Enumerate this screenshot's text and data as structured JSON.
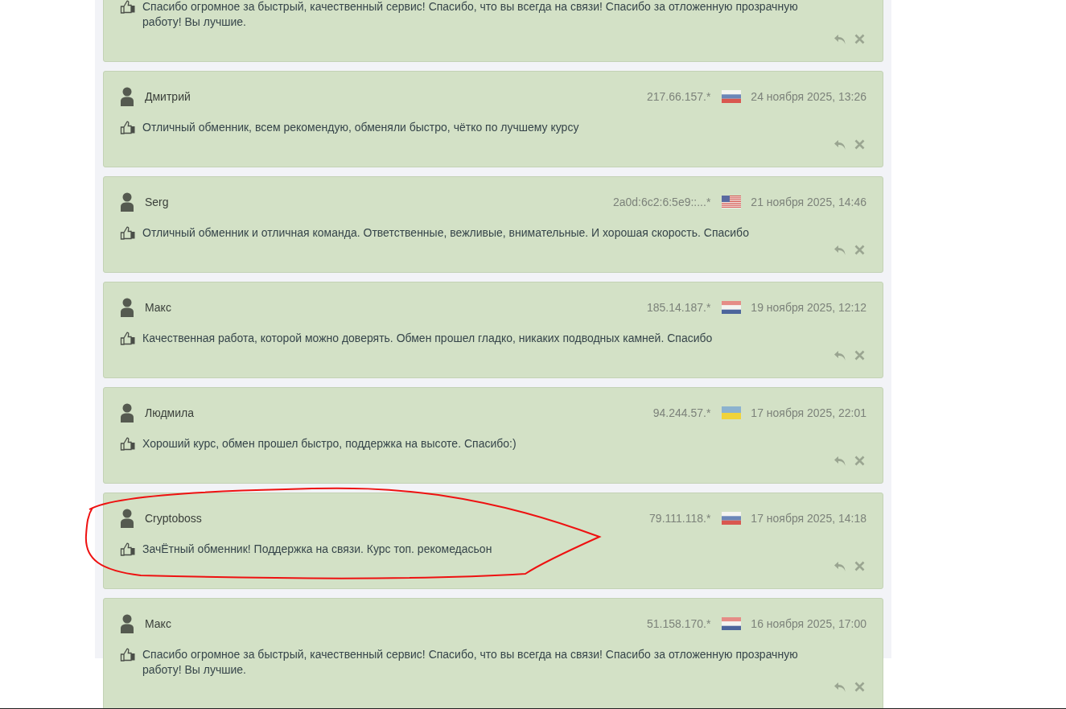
{
  "reviews": [
    {
      "text": "Спасибо огромное за быстрый, качественный сервис! Спасибо, что вы всегда на связи! Спасибо за отложенную прозрачную работу! Вы лучшие.",
      "circled": false
    },
    {
      "name": "Дмитрий",
      "ip": "217.66.157.*",
      "flag": {
        "kind": "ru"
      },
      "date": "24 ноября 2025, 13:26",
      "text": "Отличный обменник, всем рекомендую, обменяли быстро, чётко по лучшему курсу",
      "circled": false
    },
    {
      "name": "Serg",
      "ip": "2a0d:6c2:6:5e9::...*",
      "flag": {
        "kind": "us"
      },
      "date": "21 ноября 2025, 14:46",
      "text": "Отличный обменник и отличная команда. Ответственные, вежливые, внимательные. И хорошая скорость. Спасибо",
      "circled": false
    },
    {
      "name": "Макс",
      "ip": "185.14.187.*",
      "flag": {
        "kind": "nl"
      },
      "date": "19 ноября 2025, 12:12",
      "text": "Качественная работа, которой можно доверять. Обмен прошел гладко, никаких подводных камней. Спасибо",
      "circled": false
    },
    {
      "name": "Людмила",
      "ip": "94.244.57.*",
      "flag": {
        "kind": "ua"
      },
      "date": "17 ноября 2025, 22:01",
      "text": "Хороший курс, обмен прошел быстро, поддержка на высоте. Спасибо:)",
      "circled": false
    },
    {
      "name": "Cryptoboss",
      "ip": "79.111.118.*",
      "flag": {
        "kind": "ru"
      },
      "date": "17 ноября 2025, 14:18",
      "text": "ЗачЁтный обменник! Поддержка на связи. Курс топ. рекомедасьон",
      "circled": true
    },
    {
      "name": "Макс",
      "ip": "51.158.170.*",
      "flag": {
        "kind": "nl"
      },
      "date": "16 ноября 2025, 17:00",
      "text": "Спасибо огромное за быстрый, качественный сервис! Спасибо, что вы всегда на связи! Спасибо за отложенную прозрачную работу! Вы лучшие.",
      "circled": false
    }
  ]
}
